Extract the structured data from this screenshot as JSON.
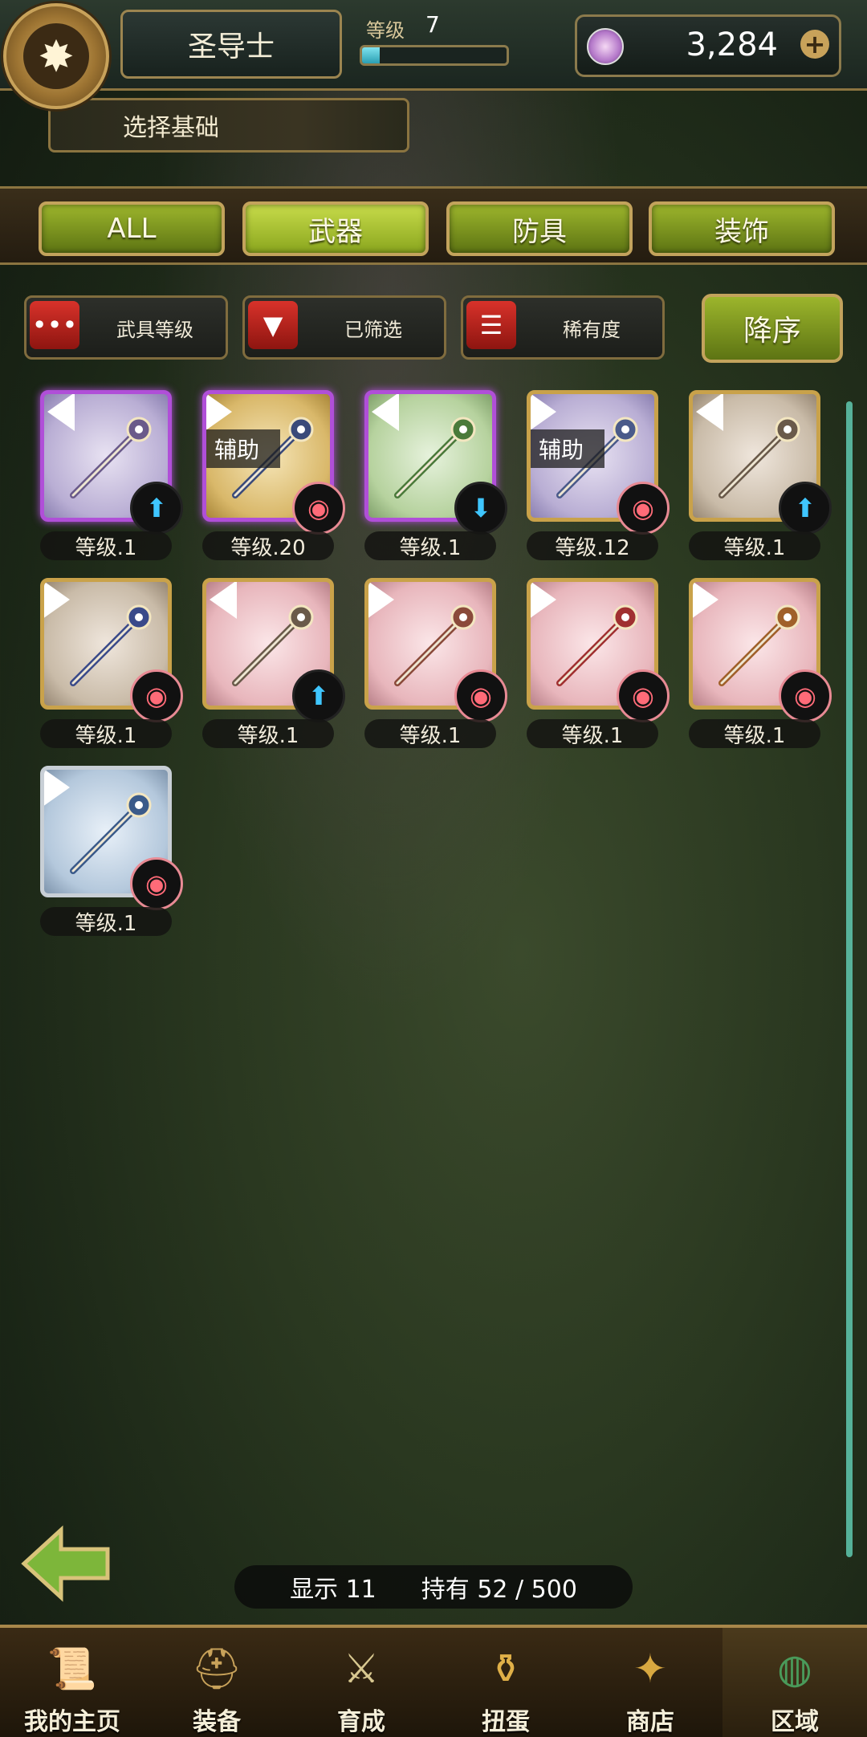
{
  "header": {
    "class_name": "圣导士",
    "level_label": "等级",
    "level_value": "7",
    "level_progress": 0.12,
    "gem_amount": "3,284",
    "gem_plus": "+",
    "sub_title": "选择基础"
  },
  "tabs": [
    {
      "label": "ALL",
      "active": false
    },
    {
      "label": "武器",
      "active": true
    },
    {
      "label": "防具",
      "active": false
    },
    {
      "label": "装饰",
      "active": false
    }
  ],
  "filters": [
    {
      "icon": "more-dots-icon",
      "glyph": "•••",
      "label": "武具等级"
    },
    {
      "icon": "funnel-filter-icon",
      "glyph": "▼",
      "label": "已筛选"
    },
    {
      "icon": "rarity-bars-icon",
      "glyph": "☰",
      "label": "稀有度"
    }
  ],
  "sort_label": "降序",
  "items": [
    {
      "level": "等级.1",
      "support": "",
      "badge": "up",
      "bg": "lavender",
      "frame": "purple",
      "flag": "grey"
    },
    {
      "level": "等级.20",
      "support": "辅助",
      "badge": "swap",
      "bg": "gold",
      "frame": "purple",
      "flag": "white"
    },
    {
      "level": "等级.1",
      "support": "",
      "badge": "down",
      "bg": "green",
      "frame": "purple",
      "flag": "grey"
    },
    {
      "level": "等级.12",
      "support": "辅助",
      "badge": "swap",
      "bg": "lavender",
      "frame": "gold",
      "flag": "white"
    },
    {
      "level": "等级.1",
      "support": "",
      "badge": "up",
      "bg": "beige",
      "frame": "gold",
      "flag": "grey"
    },
    {
      "level": "等级.1",
      "support": "",
      "badge": "swap",
      "bg": "beige",
      "frame": "gold",
      "flag": "white"
    },
    {
      "level": "等级.1",
      "support": "",
      "badge": "up",
      "bg": "pink",
      "frame": "gold",
      "flag": "grey"
    },
    {
      "level": "等级.1",
      "support": "",
      "badge": "swap",
      "bg": "pink",
      "frame": "gold",
      "flag": "white"
    },
    {
      "level": "等级.1",
      "support": "",
      "badge": "swap",
      "bg": "pink",
      "frame": "gold",
      "flag": "white"
    },
    {
      "level": "等级.1",
      "support": "",
      "badge": "swap",
      "bg": "pink",
      "frame": "gold",
      "flag": "white"
    },
    {
      "level": "等级.1",
      "support": "",
      "badge": "swap",
      "bg": "blue",
      "frame": "silver",
      "flag": "white"
    }
  ],
  "status": {
    "shown_label": "显示 11",
    "owned_label": "持有 52 / 500"
  },
  "nav": [
    {
      "label": "我的主页",
      "icon": "home-scroll-icon",
      "glyph": "📜",
      "current": false
    },
    {
      "label": "装备",
      "icon": "helmet-icon",
      "glyph": "⛑",
      "current": false
    },
    {
      "label": "育成",
      "icon": "crossed-swords-icon",
      "glyph": "⚔",
      "current": false
    },
    {
      "label": "扭蛋",
      "icon": "gacha-pot-icon",
      "glyph": "⚱",
      "current": false
    },
    {
      "label": "商店",
      "icon": "gold-shop-icon",
      "glyph": "✦",
      "current": false
    },
    {
      "label": "区域",
      "icon": "globe-icon",
      "glyph": "◍",
      "current": true
    }
  ],
  "colors": {
    "accent_green": "#8aa61e",
    "frame_gold": "#c9a24a",
    "frame_purple": "#b04fd8",
    "badge_blue": "#3fc6ff",
    "badge_pink": "#ff6b78"
  }
}
